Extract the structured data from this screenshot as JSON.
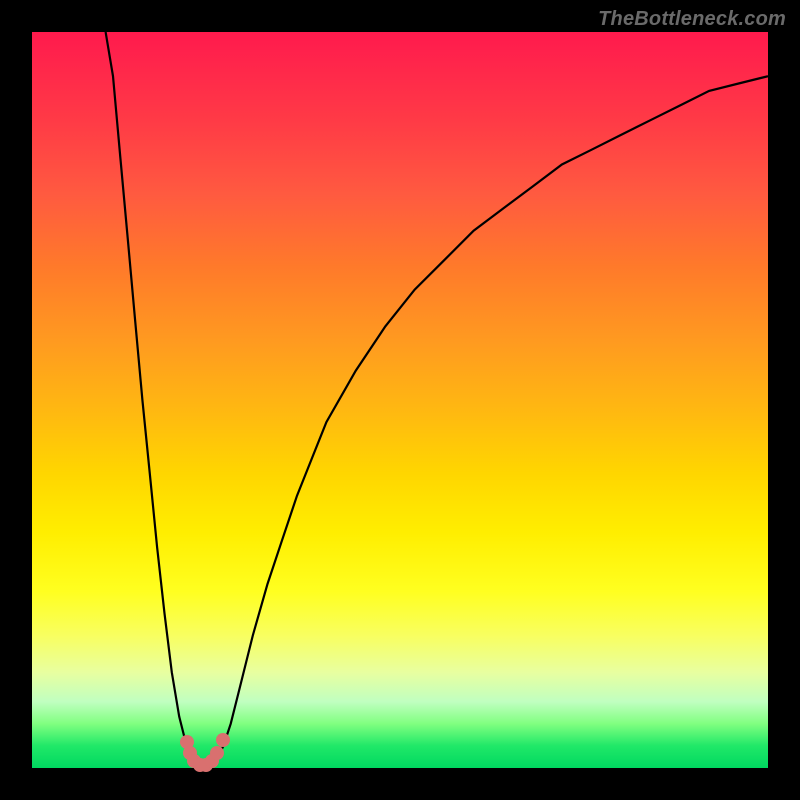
{
  "watermark_text": "TheBottleneck.com",
  "chart_data": {
    "type": "line",
    "title": "",
    "xlabel": "",
    "ylabel": "",
    "xlim": [
      0,
      100
    ],
    "ylim": [
      0,
      100
    ],
    "grid": false,
    "series": [
      {
        "name": "bottleneck-curve",
        "x": [
          10,
          11,
          12,
          13,
          14,
          15,
          16,
          17,
          18,
          19,
          20,
          21,
          22,
          23,
          24,
          25,
          26,
          27,
          28,
          30,
          32,
          34,
          36,
          38,
          40,
          44,
          48,
          52,
          56,
          60,
          64,
          68,
          72,
          76,
          80,
          84,
          88,
          92,
          96,
          100
        ],
        "y": [
          100,
          94,
          83,
          72,
          61,
          50,
          40,
          30,
          21,
          13,
          7,
          3,
          1,
          0,
          0,
          1,
          3,
          6,
          10,
          18,
          25,
          31,
          37,
          42,
          47,
          54,
          60,
          65,
          69,
          73,
          76,
          79,
          82,
          84,
          86,
          88,
          90,
          92,
          93,
          94
        ]
      }
    ],
    "markers": [
      {
        "x": 21.0,
        "y": 3.5
      },
      {
        "x": 21.5,
        "y": 2.0
      },
      {
        "x": 22.0,
        "y": 1.0
      },
      {
        "x": 22.8,
        "y": 0.4
      },
      {
        "x": 23.6,
        "y": 0.4
      },
      {
        "x": 24.4,
        "y": 1.0
      },
      {
        "x": 25.2,
        "y": 2.0
      },
      {
        "x": 26.0,
        "y": 3.8
      }
    ],
    "marker_color": "#d9706f",
    "background_gradient": [
      "#ff1a4d",
      "#ffee00",
      "#00d860"
    ]
  }
}
